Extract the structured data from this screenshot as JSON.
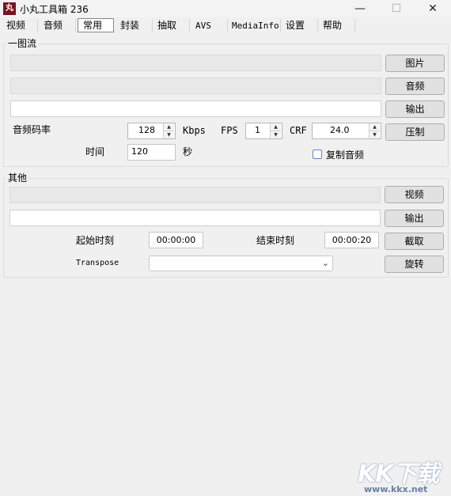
{
  "window": {
    "title": "小丸工具箱 236",
    "icon_text": "丸"
  },
  "tabs": [
    {
      "label": "视频"
    },
    {
      "label": "音频"
    },
    {
      "label": "常用"
    },
    {
      "label": "封装"
    },
    {
      "label": "抽取"
    },
    {
      "label": "AVS"
    },
    {
      "label": "MediaInfo"
    },
    {
      "label": "设置"
    },
    {
      "label": "帮助"
    }
  ],
  "group1": {
    "title": "一图流",
    "buttons": {
      "image": "图片",
      "audio": "音频",
      "output": "输出",
      "compress": "压制"
    },
    "audio_bitrate_label": "音频码率",
    "audio_bitrate_value": "128",
    "kbps_label": "Kbps",
    "fps_label": "FPS",
    "fps_value": "1",
    "crf_label": "CRF",
    "crf_value": "24.0",
    "time_label": "时间",
    "time_value": "120",
    "seconds_label": "秒",
    "copy_audio_label": "复制音频"
  },
  "group2": {
    "title": "其他",
    "buttons": {
      "video": "视频",
      "output": "输出",
      "cut": "截取",
      "rotate": "旋转"
    },
    "start_time_label": "起始时刻",
    "start_time_value": "00:00:00",
    "end_time_label": "结束时刻",
    "end_time_value": "00:00:20",
    "transpose_label": "Transpose"
  },
  "watermark": {
    "text": "KK下载",
    "url": "www.kkx.net"
  }
}
